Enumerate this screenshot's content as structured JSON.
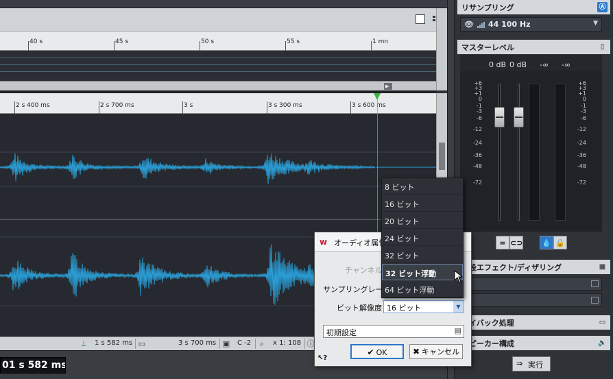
{
  "overview": {
    "ticks": [
      "40 s",
      "45 s",
      "50 s",
      "55 s",
      "1 mn"
    ]
  },
  "main_ruler": {
    "ticks": [
      "2 s 400 ms",
      "2 s 700 ms",
      "3 s",
      "3 s 300 ms",
      "3 s 600 ms"
    ]
  },
  "statusbar": {
    "cursor_pos": "1 s 582 ms",
    "length": "3 s 700 ms",
    "channel": "C -2",
    "zoom": "x 1: 108"
  },
  "time_display": "01 s 582 ms",
  "right_panel": {
    "resample_title": "リサンプリング",
    "resample_value": "44 100 Hz",
    "master_title": "マスターレベル",
    "db_left": "0 dB",
    "db_right": "0 dB",
    "inf_left": "-∞",
    "inf_right": "-∞",
    "scale_labels": [
      "+6",
      "+3",
      "+1",
      "0",
      "-1",
      "-3",
      "-6",
      "-12",
      "-24",
      "-36",
      "-48",
      "-72"
    ],
    "final_effects_title": "終段エフェクト/ディザリング",
    "playback_title": "レイバック処理",
    "speaker_title": "スピーカー構成",
    "run_label": "実行"
  },
  "dialog": {
    "title": "オーディオ属性",
    "channel_label": "チャンネル",
    "samplerate_label": "サンプリングレート",
    "bitdepth_label": "ビット解像度",
    "bitdepth_value": "16 ビット",
    "preset_value": "初期設定",
    "ok_label": "OK",
    "cancel_label": "キャンセル"
  },
  "dropdown": {
    "items": [
      "8 ビット",
      "16 ビット",
      "20 ビット",
      "24 ビット",
      "32 ビット",
      "32 ビット浮動",
      "64 ビット浮動"
    ],
    "selected_index": 5
  },
  "colors": {
    "waveform": "#2a9fd8",
    "accent": "#2c78c9",
    "cursor": "#d07aa0",
    "marker": "#3fb24a"
  }
}
